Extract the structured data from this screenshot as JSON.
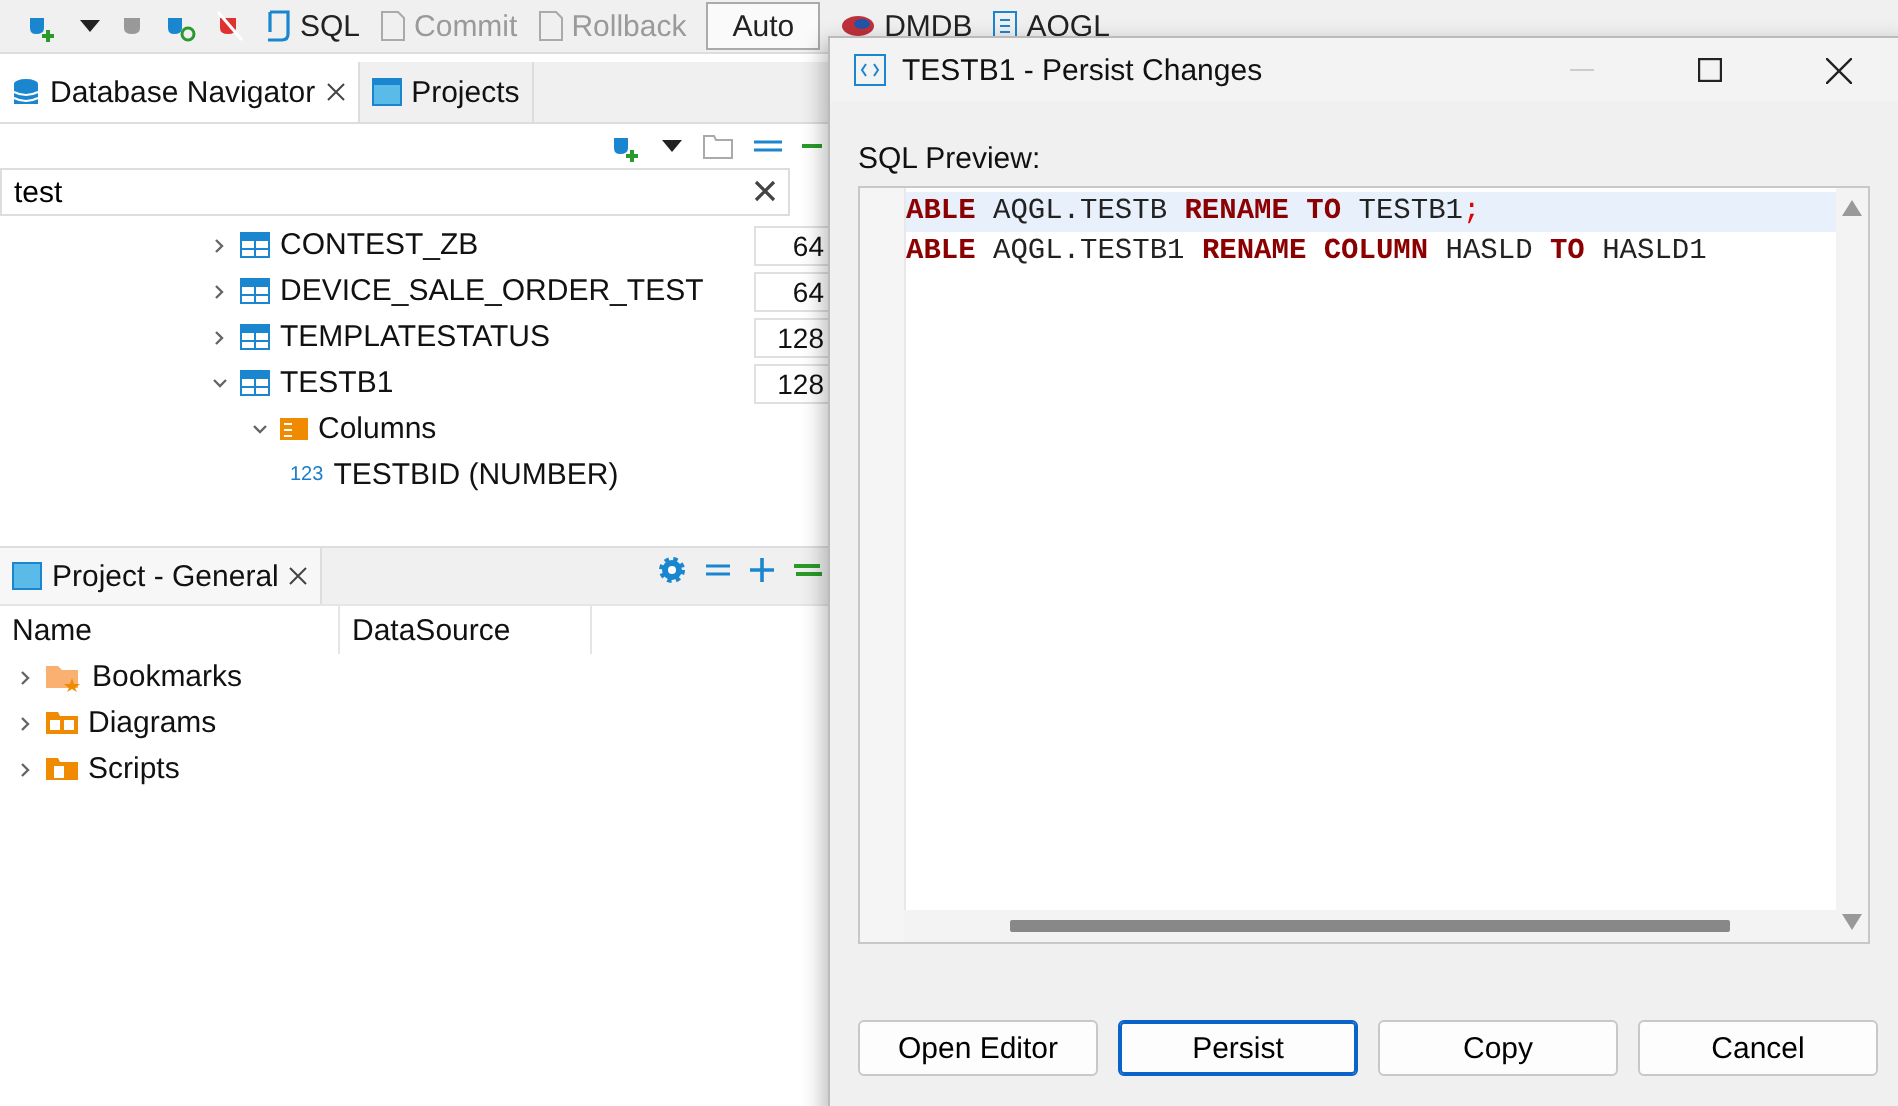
{
  "toolbar": {
    "items": [
      {
        "kind": "sql",
        "label": "SQL",
        "disabled": false
      },
      {
        "kind": "commit",
        "label": "Commit",
        "disabled": true
      },
      {
        "kind": "rollback",
        "label": "Rollback",
        "disabled": true
      },
      {
        "kind": "auto",
        "label": "Auto",
        "disabled": false
      },
      {
        "kind": "datasource",
        "label": "DMDB",
        "disabled": false
      },
      {
        "kind": "schema",
        "label": "AQGL",
        "disabled": false
      }
    ]
  },
  "navigator": {
    "tabs": [
      {
        "label": "Database Navigator",
        "selected": true,
        "closable": true
      },
      {
        "label": "Projects",
        "selected": false,
        "closable": false
      }
    ],
    "search": {
      "value": "test"
    },
    "tree": [
      {
        "kind": "table",
        "label": "CONTEST_ZB",
        "count": "64",
        "expanded": false
      },
      {
        "kind": "table",
        "label": "DEVICE_SALE_ORDER_TEST",
        "count": "64",
        "expanded": false
      },
      {
        "kind": "table",
        "label": "TEMPLATESTATUS",
        "count": "128",
        "expanded": false
      },
      {
        "kind": "table",
        "label": "TESTB1",
        "count": "128",
        "expanded": true,
        "children": [
          {
            "kind": "folder",
            "label": "Columns",
            "expanded": true,
            "children": [
              {
                "kind": "column",
                "label": "TESTBID (NUMBER)",
                "badge": "123"
              }
            ]
          }
        ]
      }
    ]
  },
  "project": {
    "tab": {
      "label": "Project - General"
    },
    "columns": [
      "Name",
      "DataSource"
    ],
    "items": [
      {
        "kind": "bookmarks",
        "label": "Bookmarks"
      },
      {
        "kind": "diagrams",
        "label": "Diagrams"
      },
      {
        "kind": "scripts",
        "label": "Scripts"
      }
    ]
  },
  "dialog": {
    "title": "TESTB1 - Persist Changes",
    "label": "SQL Preview:",
    "lines": [
      {
        "current": true,
        "tokens": [
          {
            "kind": "keyword",
            "text": "ABLE"
          },
          {
            "kind": "plain",
            "text": " AQGL.TESTB "
          },
          {
            "kind": "keyword",
            "text": "RENAME TO"
          },
          {
            "kind": "plain",
            "text": " TESTB1"
          },
          {
            "kind": "punct",
            "text": ";"
          }
        ]
      },
      {
        "current": false,
        "tokens": [
          {
            "kind": "keyword",
            "text": "ABLE"
          },
          {
            "kind": "plain",
            "text": " AQGL.TESTB1 "
          },
          {
            "kind": "keyword",
            "text": "RENAME COLUMN"
          },
          {
            "kind": "plain",
            "text": " HASLD "
          },
          {
            "kind": "keyword",
            "text": "TO"
          },
          {
            "kind": "plain",
            "text": " HASLD1"
          }
        ]
      }
    ],
    "buttons": [
      {
        "label": "Open Editor",
        "default": false
      },
      {
        "label": "Persist",
        "default": true
      },
      {
        "label": "Copy",
        "default": false
      },
      {
        "label": "Cancel",
        "default": false
      }
    ]
  }
}
